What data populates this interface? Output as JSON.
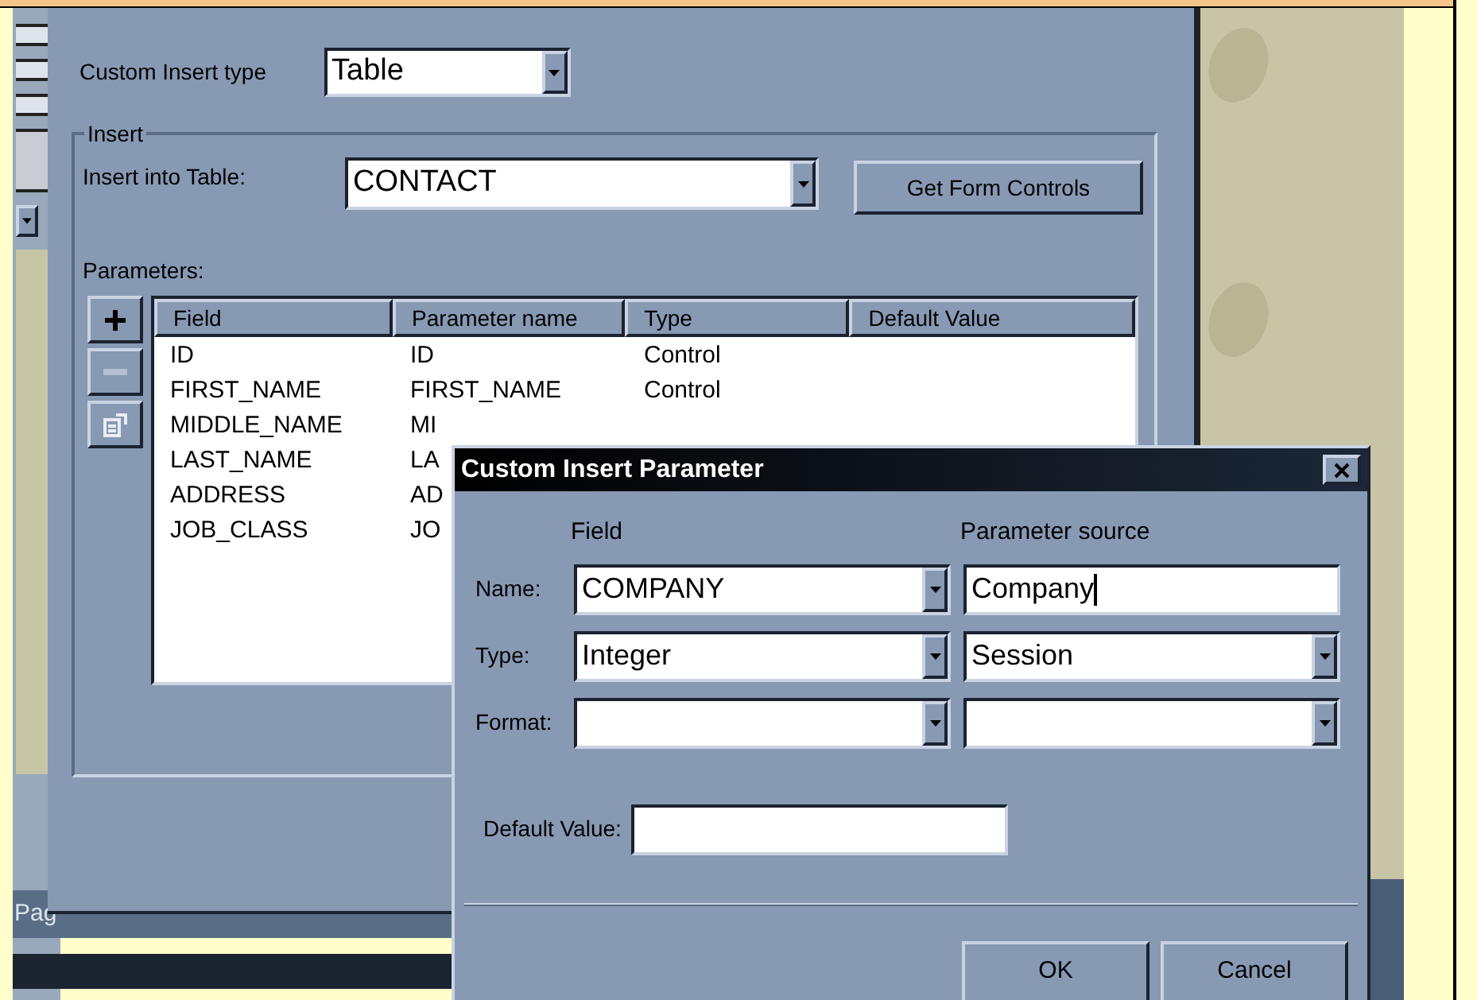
{
  "main_dialog": {
    "insert_type_label": "Custom Insert type",
    "insert_type": "Table",
    "group_title": "Insert",
    "table_label": "Insert into Table:",
    "table_value": "CONTACT",
    "get_controls_button": "Get Form Controls",
    "parameters_label": "Parameters:",
    "tool_buttons": [
      {
        "kind": "add",
        "disabled": false
      },
      {
        "kind": "remove",
        "disabled": true
      },
      {
        "kind": "properties",
        "disabled": false
      }
    ],
    "table": {
      "columns": [
        "Field",
        "Parameter name",
        "Type",
        "Default Value"
      ],
      "rows": [
        [
          "ID",
          "ID",
          "Control"
        ],
        [
          "FIRST_NAME",
          "FIRST_NAME",
          "Control"
        ],
        [
          "MIDDLE_NAME",
          "MI"
        ],
        [
          "LAST_NAME",
          "LA"
        ],
        [
          "ADDRESS",
          "AD"
        ],
        [
          "JOB_CLASS",
          "JO"
        ]
      ]
    }
  },
  "background_window": {
    "status_text": "Pag"
  },
  "param_dialog": {
    "title": "Custom Insert Parameter",
    "field_header": "Field",
    "source_header": "Parameter source",
    "rows": [
      {
        "label": "Name:",
        "field_value": "COMPANY",
        "source": {
          "kind": "text",
          "value": "Company",
          "focused": true
        }
      },
      {
        "label": "Type:",
        "field_value": "Integer",
        "source": {
          "kind": "dropdown",
          "value": "Session",
          "focused": false
        }
      },
      {
        "label": "Format:",
        "source": {
          "kind": "dropdown",
          "focused": false
        }
      }
    ],
    "default_label": "Default Value:",
    "buttons": [
      "OK",
      "Cancel"
    ]
  }
}
